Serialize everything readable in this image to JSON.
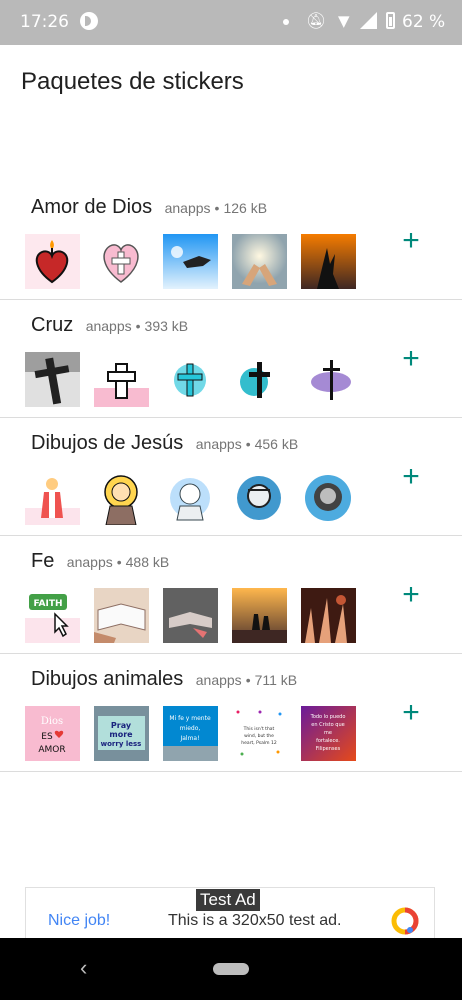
{
  "status_bar": {
    "time": "17:26",
    "battery_percent": "62 %"
  },
  "header": {
    "title": "Paquetes de stickers"
  },
  "packs": [
    {
      "name": "Amor de Dios",
      "author": "anapps",
      "separator": "•",
      "size": "126 kB"
    },
    {
      "name": "Cruz",
      "author": "anapps",
      "separator": "•",
      "size": "393 kB"
    },
    {
      "name": "Dibujos de Jesús",
      "author": "anapps",
      "separator": "•",
      "size": "456 kB"
    },
    {
      "name": "Fe",
      "author": "anapps",
      "separator": "•",
      "size": "488 kB"
    },
    {
      "name": "Dibujos animales",
      "author": "anapps",
      "separator": "•",
      "size": "711 kB"
    }
  ],
  "add_icon": "+",
  "ad": {
    "badge": "Test Ad",
    "headline": "Nice job!",
    "body": "This is a 320x50 test ad."
  },
  "stickers": {
    "faith": "FAITH",
    "dios_es_amor": [
      "Dios",
      "ES",
      "AMOR"
    ],
    "pray_more": [
      "Pray",
      "more",
      "worry less"
    ],
    "mi_fe": [
      "Mi fe y mente",
      "miedo,",
      "Jalma!"
    ],
    "verse": [
      "This isn't that",
      "wind, but the",
      "heart, Psalm 12"
    ],
    "todo_lo_puedo": [
      "Todo lo puedo",
      "en Cristo que",
      "me",
      "fortalece.",
      "Filipenses"
    ]
  },
  "colors": {
    "accent": "#00897b",
    "status_bar": "#b9b9b9",
    "ad_headline": "#4285f4"
  }
}
